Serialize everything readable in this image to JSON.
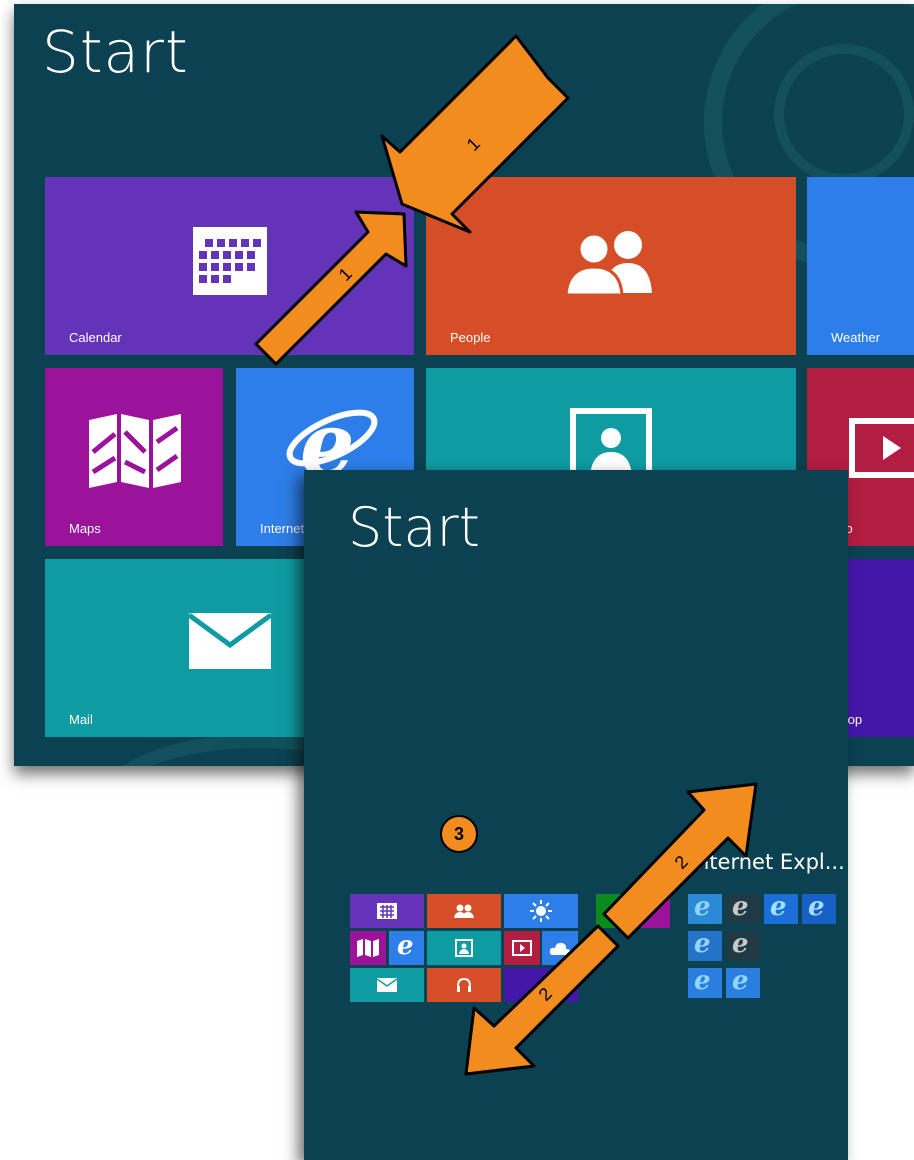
{
  "screen1": {
    "title": "Start",
    "tiles": {
      "calendar": "Calendar",
      "people": "People",
      "weather": "Weather",
      "maps": "Maps",
      "internet_explorer": "Internet",
      "video": "deo",
      "mail": "Mail",
      "desktop": "sktop"
    }
  },
  "screen2": {
    "title": "Start",
    "group_title": "nternet Expl..."
  },
  "annotations": {
    "arrow1_label": "1",
    "arrow1b_label": "1",
    "arrow2_label": "2",
    "arrow2b_label": "2",
    "marker3": "3"
  },
  "colors": {
    "background": "#0b4151",
    "purple": "#6333b8",
    "orange": "#d64e27",
    "blue": "#2d7ee8",
    "magenta": "#9b139a",
    "teal": "#0f9ba2",
    "red": "#b21d42",
    "violet": "#4517a8",
    "arrow": "#f28c1f"
  }
}
